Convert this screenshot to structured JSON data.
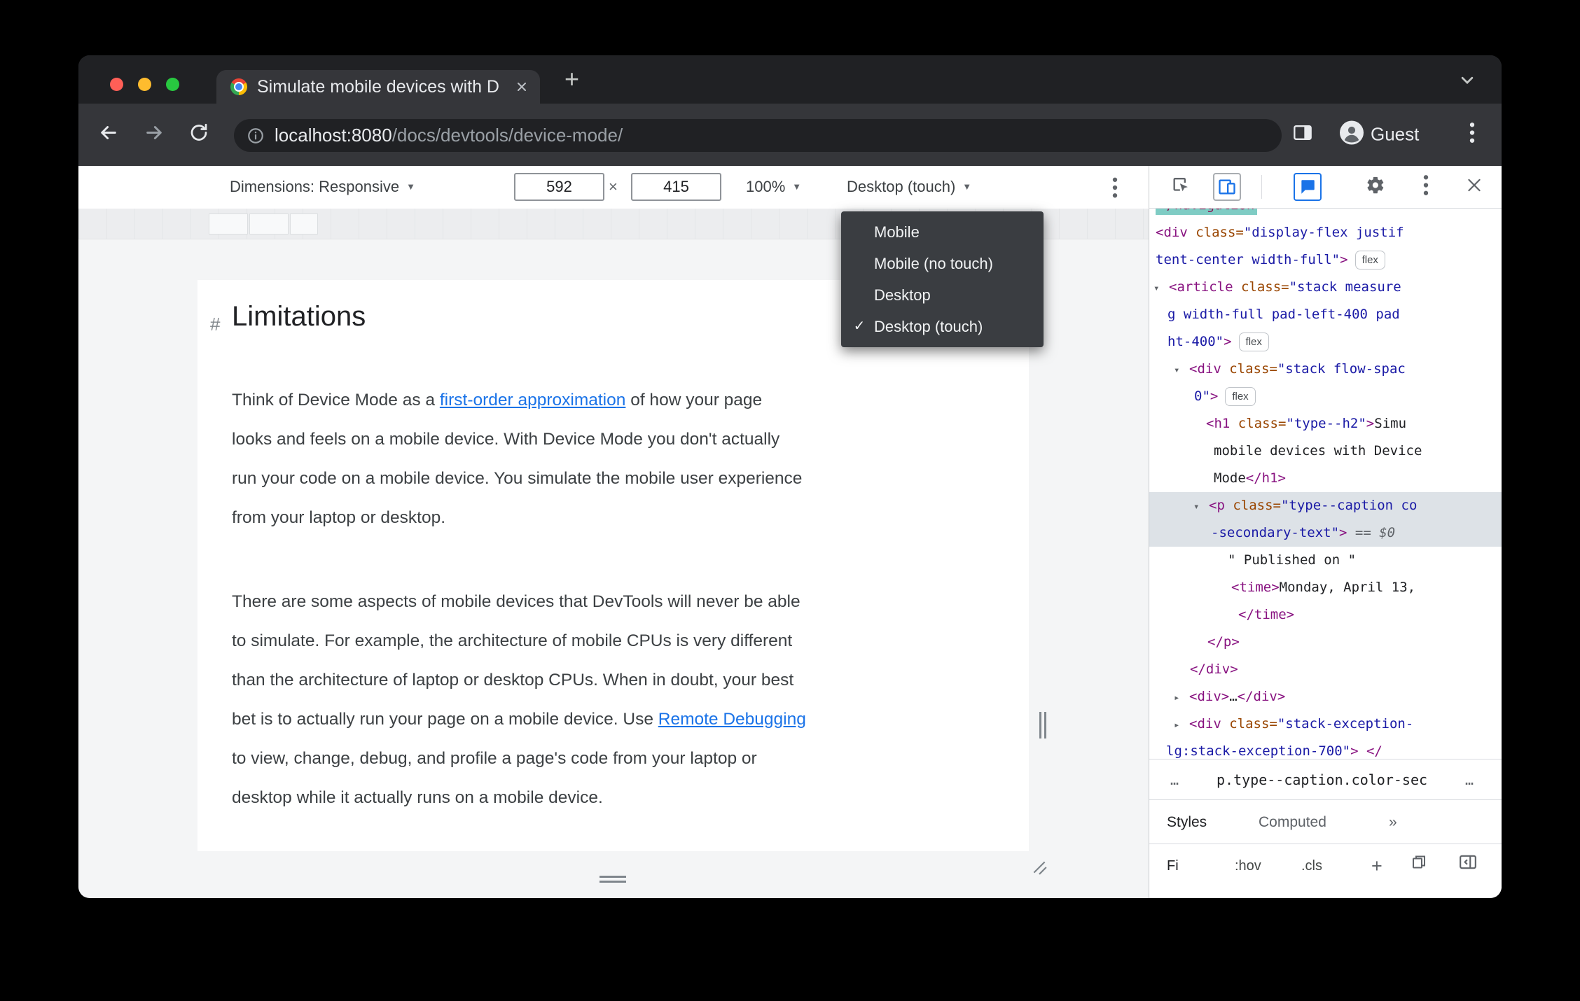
{
  "browser": {
    "tab_title": "Simulate mobile devices with D",
    "url_domain": "localhost:8080",
    "url_path": "/docs/devtools/device-mode/",
    "profile_label": "Guest"
  },
  "device_toolbar": {
    "dimensions_label": "Dimensions: Responsive",
    "width_value": "592",
    "separator": "×",
    "height_value": "415",
    "zoom_value": "100%",
    "device_type_value": "Desktop (touch)"
  },
  "dropdown": {
    "items": [
      {
        "label": "Mobile",
        "checked": false
      },
      {
        "label": "Mobile (no touch)",
        "checked": false
      },
      {
        "label": "Desktop",
        "checked": false
      },
      {
        "label": "Desktop (touch)",
        "checked": true
      }
    ]
  },
  "page": {
    "heading_hash": "#",
    "heading": "Limitations",
    "paragraphs": [
      {
        "lines": [
          [
            {
              "t": "Think of Device Mode as a "
            },
            {
              "t": "first-order approximation",
              "link": true
            },
            {
              "t": " of how your page"
            }
          ],
          [
            {
              "t": "looks and feels on a mobile device. With Device Mode you don't actually"
            }
          ],
          [
            {
              "t": "run your code on a mobile device. You simulate the mobile user experience"
            }
          ],
          [
            {
              "t": "from your laptop or desktop."
            }
          ]
        ]
      },
      {
        "lines": [
          [
            {
              "t": "There are some aspects of mobile devices that DevTools will never be able"
            }
          ],
          [
            {
              "t": "to simulate. For example, the architecture of mobile CPUs is very different"
            }
          ],
          [
            {
              "t": "than the architecture of laptop or desktop CPUs. When in doubt, your best"
            }
          ],
          [
            {
              "t": "bet is to actually run your page on a mobile device. Use "
            },
            {
              "t": "Remote Debugging",
              "link": true
            }
          ],
          [
            {
              "t": "to view, change, debug, and profile a page's code from your laptop or"
            }
          ],
          [
            {
              "t": "desktop while it actually runs on a mobile device."
            }
          ]
        ]
      }
    ]
  },
  "devtools": {
    "code_lines": [
      {
        "indent": 9,
        "segments": [
          {
            "c": "teal",
            "t": "</navigation"
          }
        ]
      },
      {
        "indent": 9,
        "segments": [
          {
            "c": "tag",
            "t": "<div"
          },
          {
            "c": "attr",
            "t": " class="
          },
          {
            "c": "val",
            "t": "\"display-flex justif"
          }
        ]
      },
      {
        "indent": 9,
        "segments": [
          {
            "c": "val",
            "t": "tent-center width-full\""
          },
          {
            "c": "tag",
            "t": ">"
          },
          {
            "c": "badge",
            "t": "flex"
          }
        ]
      },
      {
        "indent": 6,
        "segments": [
          {
            "c": "arrow",
            "t": "▾"
          },
          {
            "c": "tag",
            "t": "<article"
          },
          {
            "c": "attr",
            "t": " class="
          },
          {
            "c": "val",
            "t": "\"stack measure"
          }
        ]
      },
      {
        "indent": 26,
        "segments": [
          {
            "c": "val",
            "t": "g width-full pad-left-400 pad"
          }
        ]
      },
      {
        "indent": 26,
        "segments": [
          {
            "c": "val",
            "t": "ht-400\""
          },
          {
            "c": "tag",
            "t": ">"
          },
          {
            "c": "badge",
            "t": "flex"
          }
        ]
      },
      {
        "indent": 35,
        "segments": [
          {
            "c": "arrow",
            "t": "▾"
          },
          {
            "c": "tag",
            "t": "<div"
          },
          {
            "c": "attr",
            "t": " class="
          },
          {
            "c": "val",
            "t": "\"stack flow-spac"
          }
        ]
      },
      {
        "indent": 64,
        "segments": [
          {
            "c": "val",
            "t": "0\""
          },
          {
            "c": "tag",
            "t": ">"
          },
          {
            "c": "badge",
            "t": "flex"
          }
        ]
      },
      {
        "indent": 81,
        "segments": [
          {
            "c": "tag",
            "t": "<h1"
          },
          {
            "c": "attr",
            "t": " class="
          },
          {
            "c": "val",
            "t": "\"type--h2\""
          },
          {
            "c": "tag",
            "t": ">"
          },
          {
            "c": "txt",
            "t": "Simu"
          }
        ]
      },
      {
        "indent": 92,
        "segments": [
          {
            "c": "txt",
            "t": "mobile devices with Device"
          }
        ]
      },
      {
        "indent": 92,
        "segments": [
          {
            "c": "txt",
            "t": "Mode"
          },
          {
            "c": "tag",
            "t": "</h1>"
          }
        ]
      },
      {
        "indent": 63,
        "sel": true,
        "segments": [
          {
            "c": "arrow",
            "t": "▾"
          },
          {
            "c": "tag",
            "t": "<p"
          },
          {
            "c": "attr",
            "t": " class="
          },
          {
            "c": "val",
            "t": "\"type--caption co"
          }
        ]
      },
      {
        "indent": 88,
        "sel": true,
        "segments": [
          {
            "c": "val",
            "t": "-secondary-text\""
          },
          {
            "c": "tag",
            "t": ">"
          },
          {
            "c": "meta",
            "t": " == $0"
          }
        ]
      },
      {
        "indent": 112,
        "segments": [
          {
            "c": "txt",
            "t": "\" Published on \""
          }
        ]
      },
      {
        "indent": 117,
        "segments": [
          {
            "c": "tag",
            "t": "<time>"
          },
          {
            "c": "txt",
            "t": "Monday, April 13,"
          }
        ]
      },
      {
        "indent": 127,
        "segments": [
          {
            "c": "tag",
            "t": "</time>"
          }
        ]
      },
      {
        "indent": 83,
        "segments": [
          {
            "c": "tag",
            "t": "</p>"
          }
        ]
      },
      {
        "indent": 58,
        "segments": [
          {
            "c": "tag",
            "t": "</div>"
          }
        ]
      },
      {
        "indent": 35,
        "segments": [
          {
            "c": "arrow",
            "t": "▸"
          },
          {
            "c": "tag",
            "t": "<div>"
          },
          {
            "c": "txt",
            "t": "…"
          },
          {
            "c": "tag",
            "t": "</div>"
          }
        ]
      },
      {
        "indent": 35,
        "segments": [
          {
            "c": "arrow",
            "t": "▸"
          },
          {
            "c": "tag",
            "t": "<div"
          },
          {
            "c": "attr",
            "t": " class="
          },
          {
            "c": "val",
            "t": "\"stack-exception-"
          }
        ]
      },
      {
        "indent": 24,
        "segments": [
          {
            "c": "val",
            "t": "lg:stack-exception-700\""
          },
          {
            "c": "tag",
            "t": "> </"
          }
        ]
      }
    ],
    "breadcrumb": {
      "more_left": "…",
      "selected": "p.type--caption.color-sec",
      "more_right": "…"
    },
    "tabs": {
      "styles": "Styles",
      "computed": "Computed",
      "overflow": "»"
    },
    "filter": {
      "text": "Fi",
      "hov": ":hov",
      "cls": ".cls",
      "plus": "+"
    }
  }
}
